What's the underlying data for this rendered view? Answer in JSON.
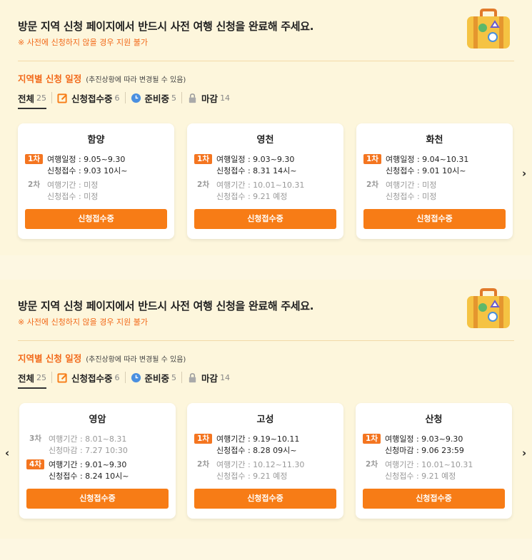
{
  "panels": [
    {
      "headline": "방문 지역 신청 페이지에서 반드시 사전 여행 신청을 완료해 주세요.",
      "note": "※ 사전에 신청하지 않을 경우 지원 불가",
      "schedule_title": "지역별 신청 일정",
      "schedule_sub": "(추진상황에 따라 변경될 수 있음)",
      "filters": [
        {
          "label": "전체",
          "count": "25"
        },
        {
          "label": "신청접수중",
          "count": "6"
        },
        {
          "label": "준비중",
          "count": "5"
        },
        {
          "label": "마감",
          "count": "14"
        }
      ],
      "cards": [
        {
          "name": "함양",
          "round1": {
            "tag": "1차",
            "line1": "여행일정 : 9.05~9.30",
            "line2": "신청접수 : 9.03 10시~"
          },
          "round2": {
            "tag": "2차",
            "line1": "여행기간 : 미정",
            "line2": "신청접수 : 미정"
          },
          "button": "신청접수중"
        },
        {
          "name": "영천",
          "round1": {
            "tag": "1차",
            "line1": "여행일정 : 9.03~9.30",
            "line2": "신청접수 : 8.31 14시~"
          },
          "round2": {
            "tag": "2차",
            "line1": "여행기간 : 10.01~10.31",
            "line2": "신청접수 : 9.21 예정"
          },
          "button": "신청접수중"
        },
        {
          "name": "화천",
          "round1": {
            "tag": "1차",
            "line1": "여행일정 : 9.04~10.31",
            "line2": "신청접수 : 9.01 10시~"
          },
          "round2": {
            "tag": "2차",
            "line1": "여행기간 : 미정",
            "line2": "신청접수 : 미정"
          },
          "button": "신청접수중"
        }
      ],
      "next_arrow": "›"
    },
    {
      "headline": "방문 지역 신청 페이지에서 반드시 사전 여행 신청을 완료해 주세요.",
      "note": "※ 사전에 신청하지 않을 경우 지원 불가",
      "schedule_title": "지역별 신청 일정",
      "schedule_sub": "(추진상황에 따라 변경될 수 있음)",
      "filters": [
        {
          "label": "전체",
          "count": "25"
        },
        {
          "label": "신청접수중",
          "count": "6"
        },
        {
          "label": "준비중",
          "count": "5"
        },
        {
          "label": "마감",
          "count": "14"
        }
      ],
      "cards": [
        {
          "name": "영암",
          "round1": {
            "tag": "3차",
            "line1": "여행기간 : 8.01~8.31",
            "line2": "신청마감 : 7.27 10:30"
          },
          "round2": {
            "tag": "4차",
            "line1": "여행기간 : 9.01~9.30",
            "line2": "신청접수 : 8.24 10시~"
          },
          "button": "신청접수중"
        },
        {
          "name": "고성",
          "round1": {
            "tag": "1차",
            "line1": "여행기간 : 9.19~10.11",
            "line2": "신청접수 : 8.28 09시~"
          },
          "round2": {
            "tag": "2차",
            "line1": "여행기간 : 10.12~11.30",
            "line2": "신청접수 : 9.21 예정"
          },
          "button": "신청접수중"
        },
        {
          "name": "산청",
          "round1": {
            "tag": "1차",
            "line1": "여행일정 : 9.03~9.30",
            "line2": "신청마감 : 9.06 23:59"
          },
          "round2": {
            "tag": "2차",
            "line1": "여행기간 : 10.01~10.31",
            "line2": "신청접수 : 9.21 예정"
          },
          "button": "신청접수중"
        }
      ],
      "prev_arrow": "‹",
      "next_arrow": "›"
    }
  ],
  "colors": {
    "accent": "#f77c16",
    "background": "#fdf6dc",
    "tag": "#f47520"
  },
  "icons": {
    "suitcase": "suitcase-icon",
    "edit": "edit-icon",
    "clock": "clock-icon",
    "lock": "lock-icon"
  }
}
